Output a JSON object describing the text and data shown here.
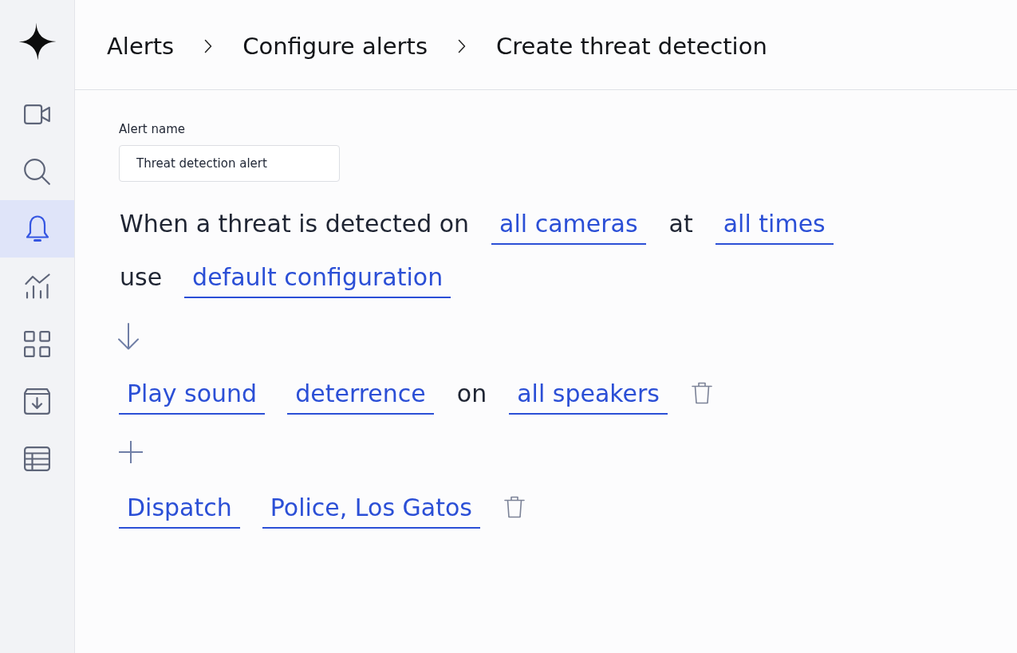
{
  "sidebar": {
    "items": [
      {
        "kind": "video",
        "selected": false
      },
      {
        "kind": "search",
        "selected": false
      },
      {
        "kind": "alerts",
        "selected": true
      },
      {
        "kind": "analytics",
        "selected": false
      },
      {
        "kind": "grid",
        "selected": false
      },
      {
        "kind": "archive",
        "selected": false
      },
      {
        "kind": "table",
        "selected": false
      }
    ]
  },
  "breadcrumb": [
    "Alerts",
    "Configure alerts",
    "Create threat detection"
  ],
  "alert_name": {
    "label": "Alert name",
    "value": "Threat detection alert"
  },
  "condition": [
    [
      {
        "kind": "text",
        "text": "When a threat is detected on"
      },
      {
        "kind": "choice",
        "text": "all cameras"
      },
      {
        "kind": "text",
        "text": "at"
      },
      {
        "kind": "choice",
        "text": "all times"
      }
    ],
    [
      {
        "kind": "text",
        "text": "use"
      },
      {
        "kind": "choice",
        "text": "default configuration"
      }
    ]
  ],
  "actions": [
    [
      {
        "kind": "choice",
        "text": "Play sound"
      },
      {
        "kind": "choice",
        "text": "deterrence"
      },
      {
        "kind": "text",
        "text": "on"
      },
      {
        "kind": "choice",
        "text": "all speakers"
      }
    ],
    [
      {
        "kind": "choice",
        "text": "Dispatch"
      },
      {
        "kind": "choice",
        "text": "Police, Los Gatos"
      }
    ]
  ]
}
